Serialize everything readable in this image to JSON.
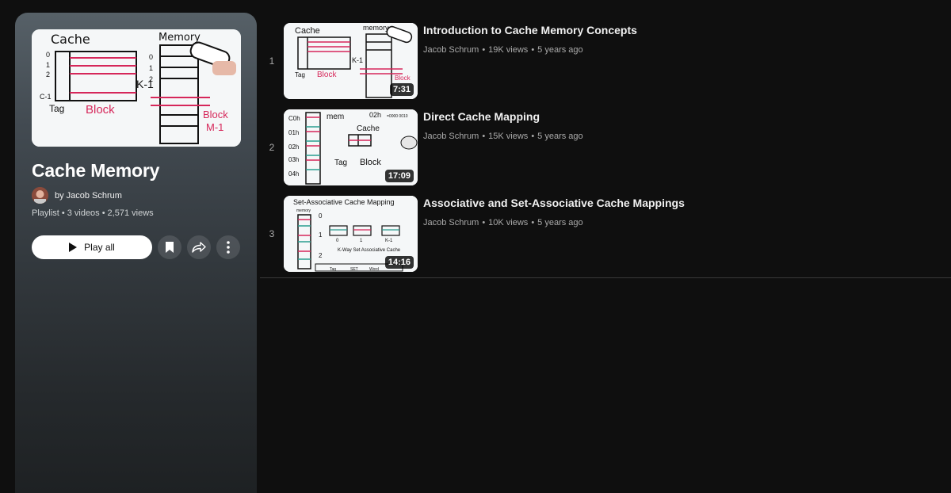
{
  "playlist": {
    "title": "Cache Memory",
    "by_prefix": "by",
    "owner": "Jacob Schrum",
    "type": "Playlist",
    "video_count": "3 videos",
    "views": "2,571 views",
    "play_all_label": "Play all",
    "thumbnail_icon": "cache-diagram-thumbnail"
  },
  "actions": {
    "save_icon": "bookmark-icon",
    "share_icon": "share-icon",
    "more_icon": "more-vert-icon"
  },
  "videos": [
    {
      "index": "1",
      "title": "Introduction to Cache Memory Concepts",
      "channel": "Jacob Schrum",
      "views": "19K views",
      "age": "5 years ago",
      "duration": "7:31"
    },
    {
      "index": "2",
      "title": "Direct Cache Mapping",
      "channel": "Jacob Schrum",
      "views": "15K views",
      "age": "5 years ago",
      "duration": "17:09"
    },
    {
      "index": "3",
      "title": "Associative and Set-Associative Cache Mappings",
      "channel": "Jacob Schrum",
      "views": "10K views",
      "age": "5 years ago",
      "duration": "14:16"
    }
  ],
  "colors": {
    "background": "#0f0f0f",
    "accent_red": "#d6275a",
    "text_primary": "#f1f1f1",
    "text_secondary": "#aaaaaa"
  }
}
